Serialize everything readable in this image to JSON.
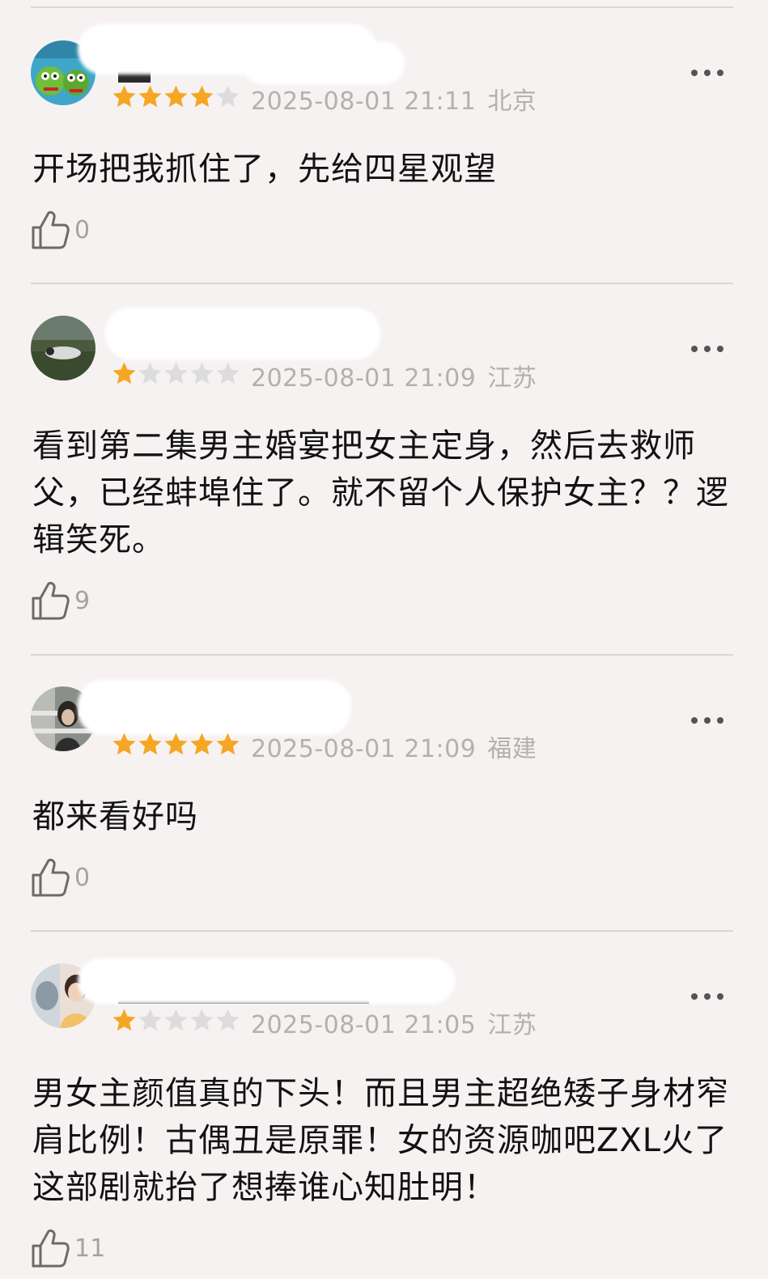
{
  "colors": {
    "background": "#f7f2f2",
    "star_filled": "#f5a623",
    "star_empty": "#dcdcdc",
    "meta_text": "#b4b0b0",
    "divider": "#dcd7d7"
  },
  "icons": {
    "more": "more-dots-icon",
    "like": "thumbs-up-icon"
  },
  "comments": [
    {
      "rating": 4,
      "stars_out_of": 5,
      "datetime": "2025-08-01 21:11",
      "location": "北京",
      "content": "开场把我抓住了，先给四星观望",
      "likes": "0"
    },
    {
      "rating": 1,
      "stars_out_of": 5,
      "datetime": "2025-08-01 21:09",
      "location": "江苏",
      "content": "看到第二集男主婚宴把女主定身，然后去救师父，已经蚌埠住了。就不留个人保护女主？？逻辑笑死。",
      "likes": "9"
    },
    {
      "rating": 5,
      "stars_out_of": 5,
      "datetime": "2025-08-01 21:09",
      "location": "福建",
      "content": "都来看好吗",
      "likes": "0"
    },
    {
      "rating": 1,
      "stars_out_of": 5,
      "datetime": "2025-08-01 21:05",
      "location": "江苏",
      "content": "男女主颜值真的下头！而且男主超绝矮子身材窄肩比例！古偶丑是原罪！女的资源咖吧ZXL火了这部剧就抬了想捧谁心知肚明！",
      "likes": "11"
    }
  ]
}
